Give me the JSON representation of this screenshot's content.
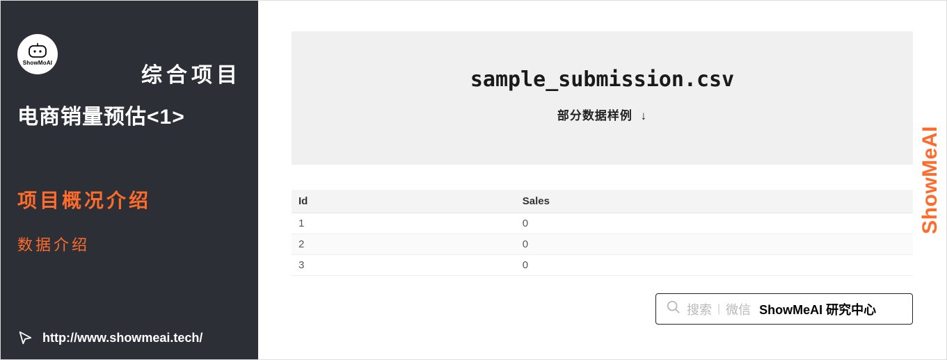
{
  "sidebar": {
    "logo_label": "ShowMoAI",
    "title_line1": "综合项目",
    "title_line2": "电商销量预估<1>",
    "nav": {
      "item1": "项目概况介绍",
      "item2": "数据介绍"
    },
    "footer_url": "http://www.showmeai.tech/"
  },
  "main": {
    "card_title": "sample_submission.csv",
    "card_subtitle": "部分数据样例",
    "card_arrow": "↓",
    "table": {
      "headers": [
        "Id",
        "Sales"
      ],
      "rows": [
        [
          "1",
          "0"
        ],
        [
          "2",
          "0"
        ],
        [
          "3",
          "0"
        ]
      ]
    }
  },
  "search": {
    "label1": "搜索",
    "label2": "微信",
    "bold": "ShowMeAI 研究中心"
  },
  "watermark": "ShowMeAI"
}
